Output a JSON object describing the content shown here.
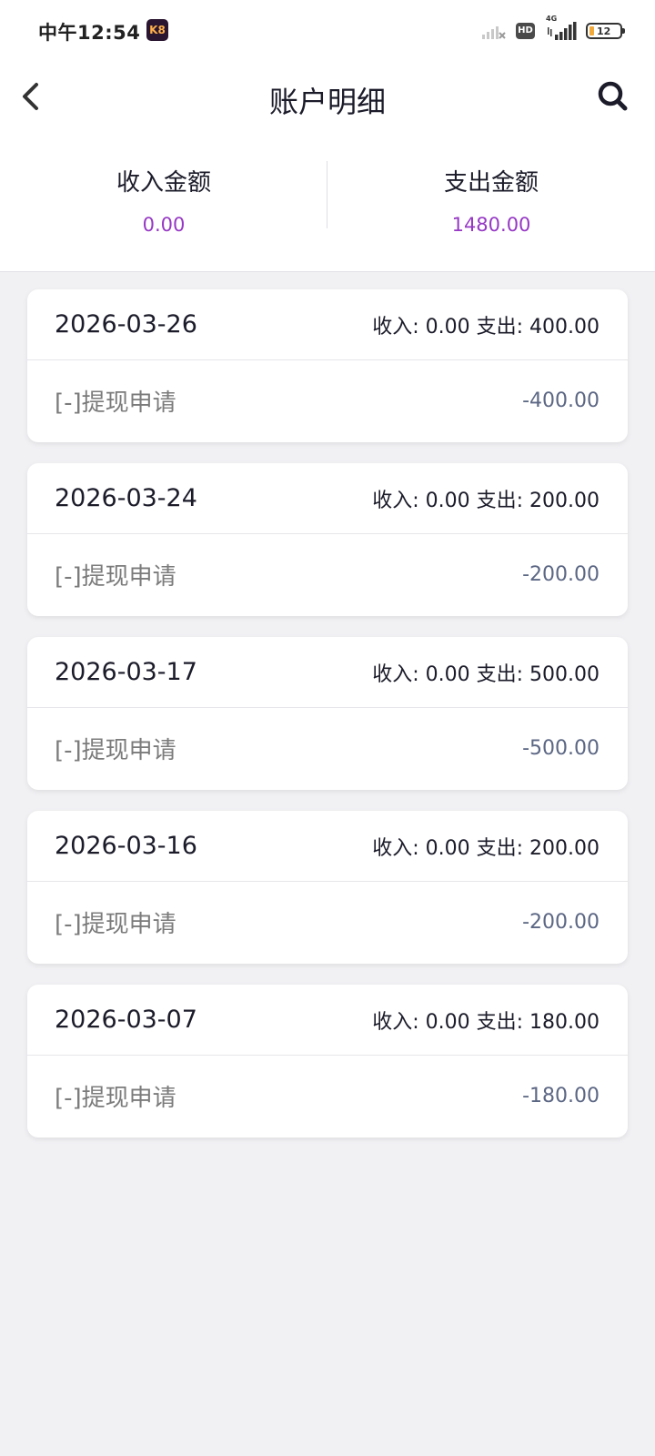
{
  "status_bar": {
    "time": "中午12:54",
    "app_badge": "K8",
    "hd": "HD",
    "network": "4G",
    "battery": "12"
  },
  "nav": {
    "title": "账户明细"
  },
  "summary": {
    "income_label": "收入金额",
    "income_value": "0.00",
    "expense_label": "支出金额",
    "expense_value": "1480.00"
  },
  "records": [
    {
      "date": "2026-03-26",
      "totals": "收入: 0.00 支出: 400.00",
      "desc": "[-]提现申请",
      "amount": "-400.00"
    },
    {
      "date": "2026-03-24",
      "totals": "收入: 0.00 支出: 200.00",
      "desc": "[-]提现申请",
      "amount": "-200.00"
    },
    {
      "date": "2026-03-17",
      "totals": "收入: 0.00 支出: 500.00",
      "desc": "[-]提现申请",
      "amount": "-500.00"
    },
    {
      "date": "2026-03-16",
      "totals": "收入: 0.00 支出: 200.00",
      "desc": "[-]提现申请",
      "amount": "-200.00"
    },
    {
      "date": "2026-03-07",
      "totals": "收入: 0.00 支出: 180.00",
      "desc": "[-]提现申请",
      "amount": "-180.00"
    }
  ],
  "colors": {
    "accent": "#9638c4",
    "amount": "#5c6784",
    "background": "#f1f1f4"
  },
  "icons": {
    "back": "chevron-left-icon",
    "search": "search-icon"
  }
}
